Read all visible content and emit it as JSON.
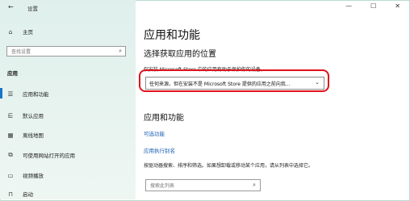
{
  "window": {
    "title": "设置",
    "minimize": "—",
    "maximize": "☐",
    "close": "✕"
  },
  "sidebar": {
    "home": "主页",
    "search_placeholder": "查找设置",
    "section": "应用",
    "items": [
      {
        "label": "应用和功能",
        "icon": "apps-list-icon",
        "glyph": "☰"
      },
      {
        "label": "默认应用",
        "icon": "default-apps-icon",
        "glyph": "⋿"
      },
      {
        "label": "离线地图",
        "icon": "offline-maps-icon",
        "glyph": "▦"
      },
      {
        "label": "可使用网站打开的应用",
        "icon": "website-apps-icon",
        "glyph": "⧉"
      },
      {
        "label": "视频播放",
        "icon": "video-icon",
        "glyph": "▭"
      },
      {
        "label": "启动",
        "icon": "startup-icon",
        "glyph": "⊓"
      }
    ],
    "accent": "#1a73c9"
  },
  "main": {
    "title": "应用和功能",
    "choose_heading": "选择获取应用的位置",
    "choose_text": "仅安装 Microsoft Store 中的应用有助于保护你的设备。",
    "dropdown_value": "任何来源，但在安装不是 Microsoft Store 提供的应用之前向我...",
    "section2_heading": "应用和功能",
    "link_optional": "可选功能",
    "link_aliases": "应用执行别名",
    "desc": "按驱动器搜索、排序和筛选。如果想卸载或移动某个应用，请从列表中选择它。",
    "list_search_placeholder": "搜索此列表"
  },
  "highlight_color": "#e0121b"
}
